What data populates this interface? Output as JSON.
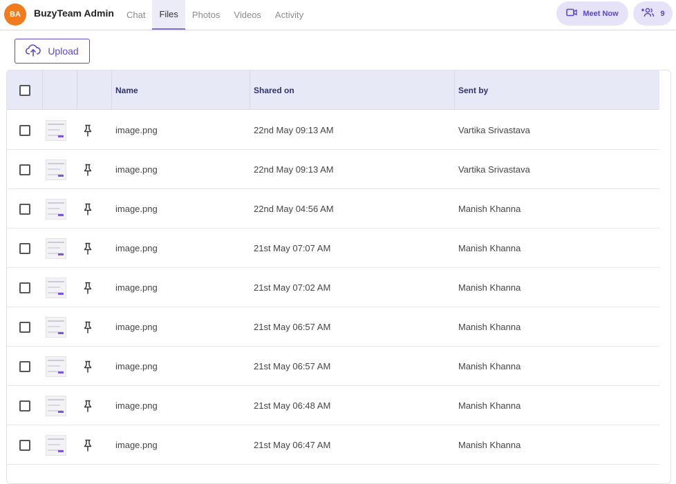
{
  "header": {
    "avatar_initials": "BA",
    "title": "BuzyTeam Admin",
    "tabs": [
      {
        "label": "Chat",
        "active": false
      },
      {
        "label": "Files",
        "active": true
      },
      {
        "label": "Photos",
        "active": false
      },
      {
        "label": "Videos",
        "active": false
      },
      {
        "label": "Activity",
        "active": false
      }
    ],
    "meet_now_label": "Meet Now",
    "members_count": "9"
  },
  "upload": {
    "label": "Upload"
  },
  "table": {
    "columns": {
      "name": "Name",
      "shared_on": "Shared on",
      "sent_by": "Sent by"
    },
    "rows": [
      {
        "name": "image.png",
        "shared_on": "22nd May 09:13 AM",
        "sent_by": "Vartika Srivastava"
      },
      {
        "name": "image.png",
        "shared_on": "22nd May 09:13 AM",
        "sent_by": "Vartika Srivastava"
      },
      {
        "name": "image.png",
        "shared_on": "22nd May 04:56 AM",
        "sent_by": "Manish Khanna"
      },
      {
        "name": "image.png",
        "shared_on": "21st May 07:07 AM",
        "sent_by": "Manish Khanna"
      },
      {
        "name": "image.png",
        "shared_on": "21st May 07:02 AM",
        "sent_by": "Manish Khanna"
      },
      {
        "name": "image.png",
        "shared_on": "21st May 06:57 AM",
        "sent_by": "Manish Khanna"
      },
      {
        "name": "image.png",
        "shared_on": "21st May 06:57 AM",
        "sent_by": "Manish Khanna"
      },
      {
        "name": "image.png",
        "shared_on": "21st May 06:48 AM",
        "sent_by": "Manish Khanna"
      },
      {
        "name": "image.png",
        "shared_on": "21st May 06:47 AM",
        "sent_by": "Manish Khanna"
      }
    ]
  },
  "colors": {
    "accent": "#5b4bc4",
    "avatar": "#f07c1d",
    "header_bg": "#e8e9f7"
  }
}
